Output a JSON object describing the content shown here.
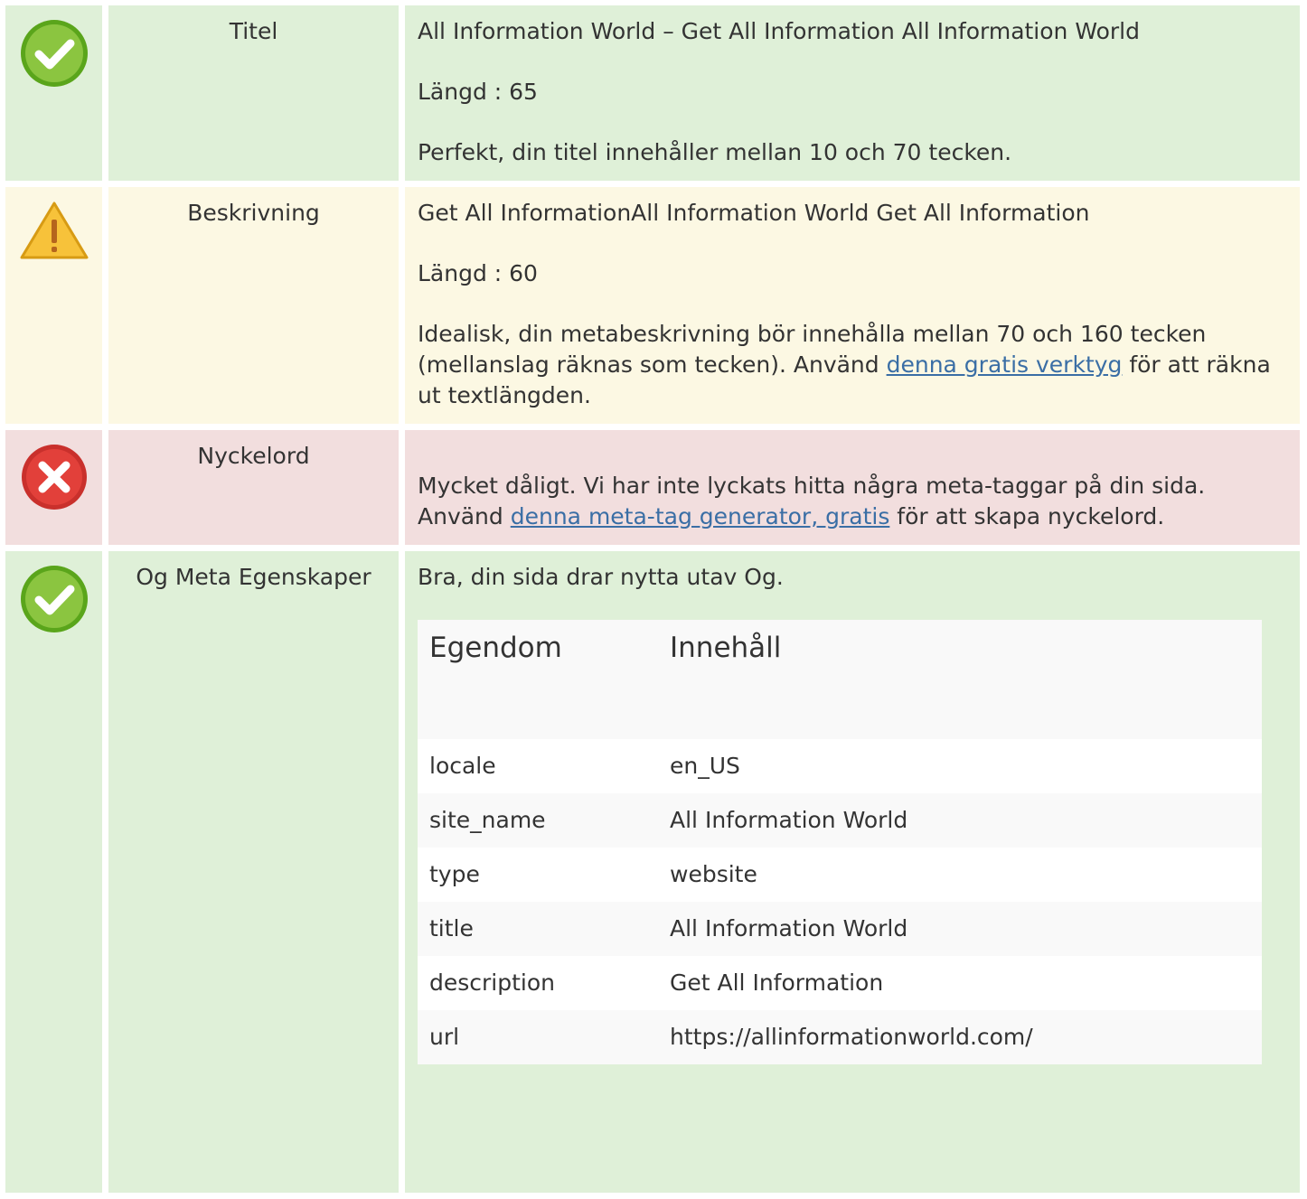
{
  "rows": {
    "title": {
      "status_icon": "check-icon",
      "name": "Titel",
      "value": "All Information World – Get All Information All Information World",
      "length": "Längd : 65",
      "message": "Perfekt, din titel innehåller mellan 10 och 70 tecken."
    },
    "description": {
      "status_icon": "warning-icon",
      "name": "Beskrivning",
      "value": "Get All InformationAll Information World Get All Information",
      "length": "Längd : 60",
      "message_before": "Idealisk, din metabeskrivning bör innehålla mellan 70 och 160 tecken (mellanslag räknas som tecken). Använd ",
      "link": "denna gratis verktyg",
      "message_after": " för att räkna ut textlängden."
    },
    "keywords": {
      "status_icon": "error-icon",
      "name": "Nyckelord",
      "message_before": "Mycket dåligt. Vi har inte lyckats hitta några meta-taggar på din sida. Använd ",
      "link": "denna meta-tag generator, gratis",
      "message_after": " för att skapa nyckelord."
    },
    "og": {
      "status_icon": "check-icon",
      "name": "Og Meta Egenskaper",
      "message": "Bra, din sida drar nytta utav Og.",
      "table": {
        "headers": [
          "Egendom",
          "Innehåll"
        ],
        "rows": [
          [
            "locale",
            "en_US"
          ],
          [
            "site_name",
            "All Information World"
          ],
          [
            "type",
            "website"
          ],
          [
            "title",
            "All Information World"
          ],
          [
            "description",
            "Get All Information"
          ],
          [
            "url",
            "https://allinformationworld.com/"
          ]
        ]
      }
    }
  },
  "colors": {
    "ok_bg": "#dff0d8",
    "warn_bg": "#fcf8e3",
    "bad_bg": "#f2dede",
    "link": "#3a6ea5"
  }
}
